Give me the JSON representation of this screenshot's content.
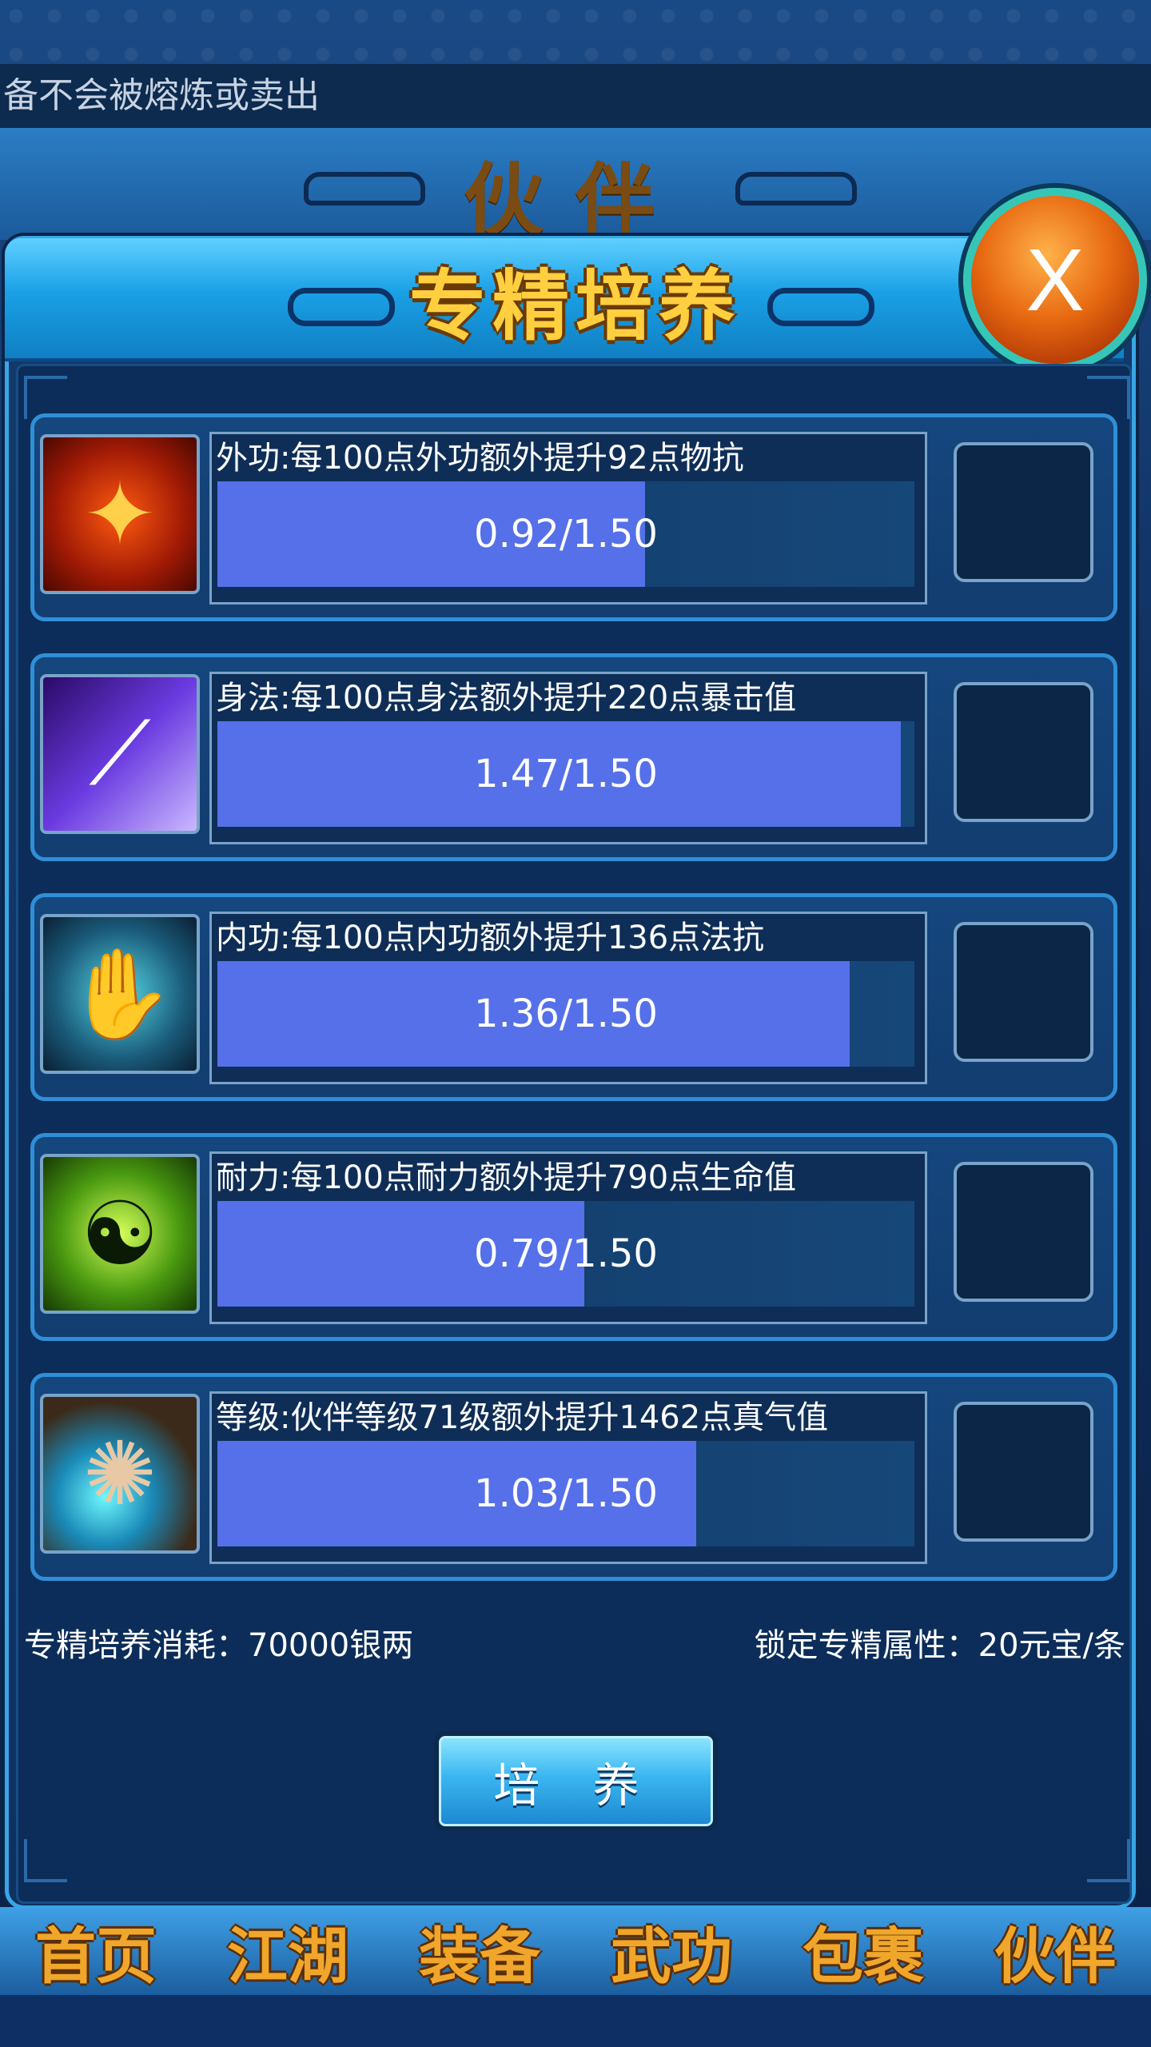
{
  "notice": {
    "text": "备不会被熔炼或卖出"
  },
  "background_panel": {
    "title": "伙伴"
  },
  "dialog": {
    "title": "专精培养",
    "close_label": "X"
  },
  "skills": [
    {
      "icon": "strength-aura-icon",
      "label": "外功:每100点外功额外提升92点物抗",
      "progress": "0.92/1.50",
      "value": 0.92,
      "max": 1.5
    },
    {
      "icon": "slash-icon",
      "label": "身法:每100点身法额外提升220点暴击值",
      "progress": "1.47/1.50",
      "value": 1.47,
      "max": 1.5
    },
    {
      "icon": "energy-hand-icon",
      "label": "内功:每100点内功额外提升136点法抗",
      "progress": "1.36/1.50",
      "value": 1.36,
      "max": 1.5
    },
    {
      "icon": "meditation-icon",
      "label": "耐力:每100点耐力额外提升790点生命值",
      "progress": "0.79/1.50",
      "value": 0.79,
      "max": 1.5
    },
    {
      "icon": "energy-orb-icon",
      "label": "等级:伙伴等级71级额外提升1462点真气值",
      "progress": "1.03/1.50",
      "value": 1.03,
      "max": 1.5
    }
  ],
  "footer": {
    "cost_text": "专精培养消耗：70000银两",
    "lock_text": "锁定专精属性：20元宝/条",
    "train_label": "培 养"
  },
  "bottom_nav": [
    "首页",
    "江湖",
    "装备",
    "武功",
    "包裹",
    "伙伴"
  ],
  "colors": {
    "progress_fill": "#5570e8",
    "title_gold": "#ffcf3f",
    "close_orange": "#e86a12"
  }
}
